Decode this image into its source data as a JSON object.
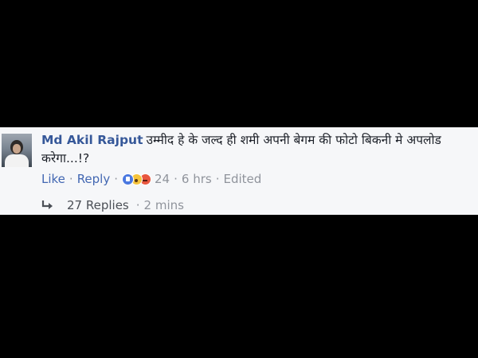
{
  "comment": {
    "author": "Md Akil Rajput",
    "text": "उम्मीद हे के जल्द ही शमी अपनी बेगम की फोटो बिकनी मे अपलोड करेगा...!?",
    "actions": {
      "like_label": "Like",
      "reply_label": "Reply",
      "reaction_count": "24",
      "time": "6 hrs",
      "edited_label": "Edited"
    },
    "reactions": [
      "like",
      "wow",
      "angry"
    ],
    "replies": {
      "label": "27 Replies",
      "time": "2 mins"
    }
  },
  "colors": {
    "background": "#000000",
    "panel": "#f6f7f9",
    "author": "#365899",
    "link": "#4267b2",
    "meta": "#90949c"
  },
  "icons": {
    "reply_arrow": "reply-arrow-icon"
  }
}
